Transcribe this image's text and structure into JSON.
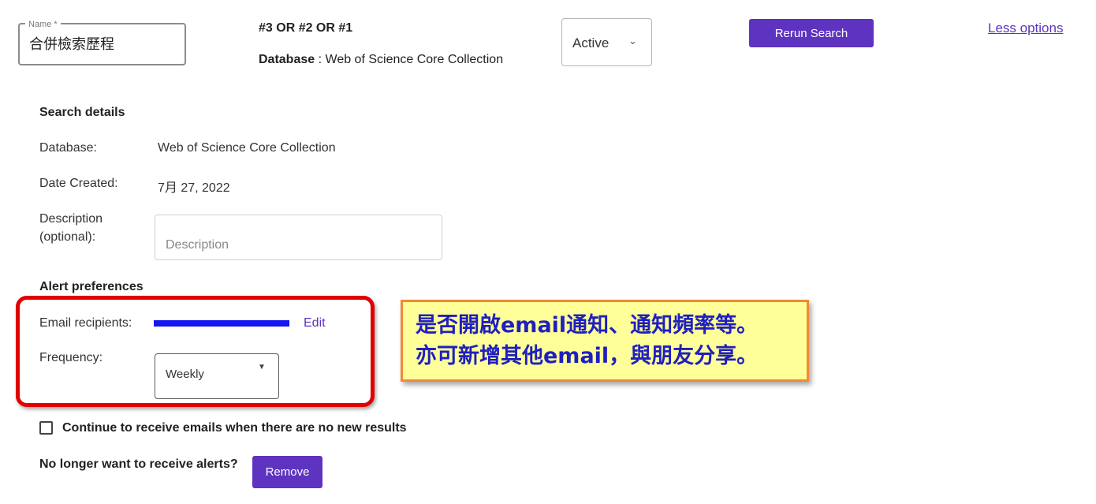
{
  "header": {
    "name_label": "Name *",
    "name_value": "合併檢索歷程",
    "query": "#3 OR #2 OR #1",
    "database_label": "Database",
    "database_separator": " : ",
    "database_value": "Web of Science Core Collection",
    "status": {
      "selected": "Active",
      "chevron": "⌄"
    },
    "rerun_label": "Rerun Search",
    "less_options_label": "Less options"
  },
  "details": {
    "title": "Search details",
    "database_label": "Database:",
    "database_value": "Web of Science Core Collection",
    "date_label": "Date Created:",
    "date_value": "7月 27, 2022",
    "description_label_line1": "Description",
    "description_label_line2": "(optional):",
    "description_placeholder": "Description"
  },
  "alerts": {
    "title": "Alert preferences",
    "email_label": "Email recipients:",
    "edit_label": "Edit",
    "frequency_label": "Frequency:",
    "frequency_value": "Weekly",
    "frequency_caret": "▼",
    "continue_label": "Continue to receive emails when there are no new results",
    "no_longer_label": "No longer want to receive alerts?",
    "remove_label": "Remove"
  },
  "callout": {
    "line1": "是否開啟email通知、通知頻率等。",
    "line2": "亦可新增其他email，與朋友分享。"
  },
  "colors": {
    "accent": "#5e33bf",
    "highlight_frame": "#e00000",
    "callout_background": "#ffff99",
    "callout_border": "#f08a35",
    "callout_text": "#1f1fbf",
    "redaction": "#1515f0"
  }
}
